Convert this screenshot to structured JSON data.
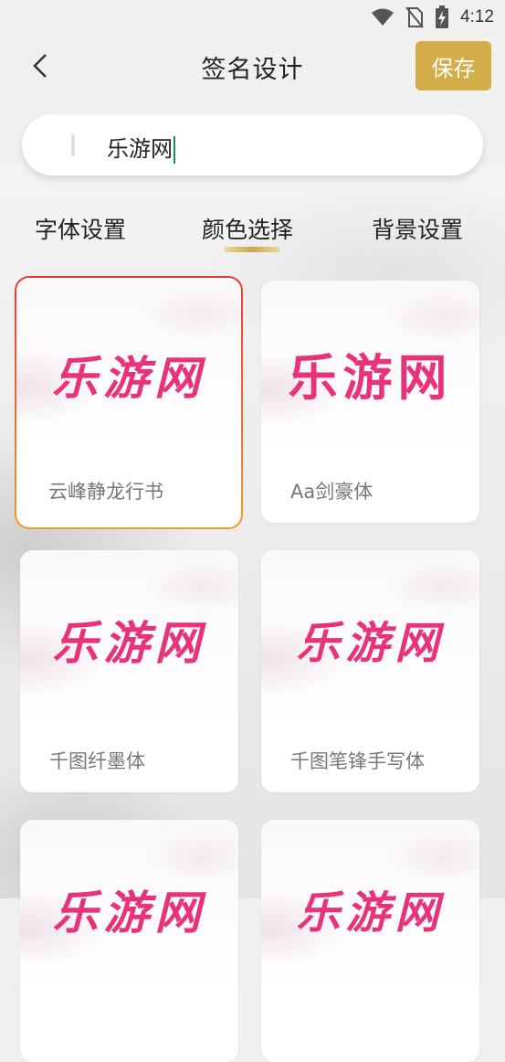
{
  "status": {
    "time": "4:12"
  },
  "header": {
    "title": "签名设计",
    "save_label": "保存"
  },
  "search": {
    "value": "乐游网"
  },
  "tabs": [
    {
      "label": "字体设置"
    },
    {
      "label": "颜色选择"
    },
    {
      "label": "背景设置"
    }
  ],
  "active_tab": 1,
  "cards": [
    {
      "preview": "乐游网",
      "font_name": "云峰静龙行书",
      "selected": true
    },
    {
      "preview": "乐游网",
      "font_name": "Aa剑豪体",
      "selected": false
    },
    {
      "preview": "乐游网",
      "font_name": "千图纤墨体",
      "selected": false
    },
    {
      "preview": "乐游网",
      "font_name": "千图笔锋手写体",
      "selected": false
    },
    {
      "preview": "乐游网",
      "font_name": "",
      "selected": false
    },
    {
      "preview": "乐游网",
      "font_name": "",
      "selected": false
    }
  ],
  "colors": {
    "accent": "#d2ad4a",
    "signature": "#e8337a",
    "selected_border": "#ee3535"
  }
}
